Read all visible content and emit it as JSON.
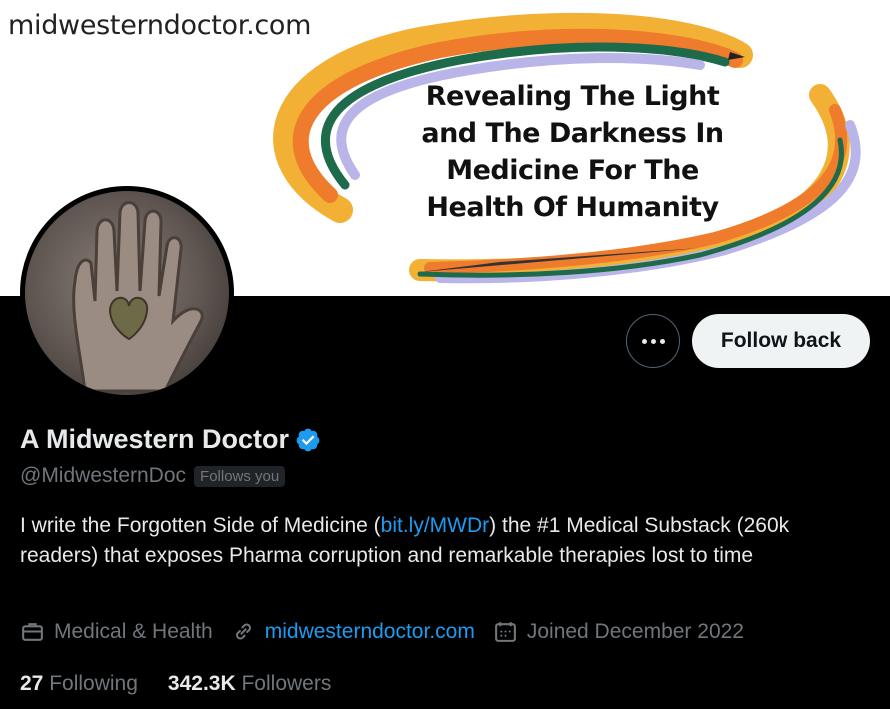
{
  "banner": {
    "site_text": "midwesterndoctor.com",
    "tagline_lines": [
      "Revealing The Light",
      "and The Darkness In",
      "Medicine For The",
      "Health Of Humanity"
    ]
  },
  "actions": {
    "more_icon": "more-icon",
    "follow_label": "Follow back"
  },
  "profile": {
    "display_name": "A Midwestern Doctor",
    "handle": "@MidwesternDoc",
    "follows_you": "Follows you",
    "bio_prefix": "I write the Forgotten Side of Medicine (",
    "bio_link": "bit.ly/MWDr",
    "bio_suffix": ") the #1 Medical Substack (260k readers) that exposes Pharma corruption and remarkable therapies lost to time",
    "category": "Medical & Health",
    "website": "midwesterndoctor.com",
    "joined": "Joined December 2022"
  },
  "stats": {
    "following_count": "27",
    "following_label": "Following",
    "followers_count": "342.3K",
    "followers_label": "Followers"
  },
  "colors": {
    "accent": "#1d9bf0",
    "background": "#000000",
    "muted": "#71767b"
  }
}
